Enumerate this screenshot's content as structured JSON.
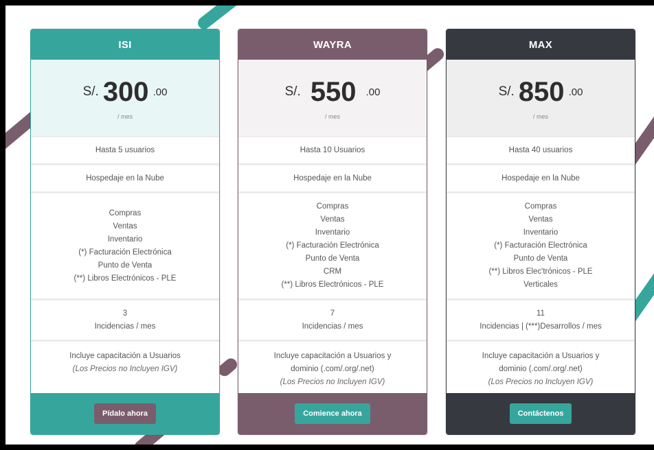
{
  "colors": {
    "teal": "#36a69d",
    "mauve": "#7a5d6d",
    "dark": "#363a40",
    "teal_tint": "#e9f6f6",
    "mauve_tint": "#f5f2f3",
    "dark_tint": "#eeeeef"
  },
  "plans": [
    {
      "name": "ISI",
      "currency": "S/.",
      "amount": "300",
      "decimals": ".00",
      "period": "/ mes",
      "users": "Hasta 5 usuarios",
      "hosting": "Hospedaje en la Nube",
      "features": [
        "Compras",
        "Ventas",
        "Inventario",
        "(*) Facturación Electrónica",
        "Punto de Venta",
        "(**) Libros Electrónicos - PLE"
      ],
      "incidents_count": "3",
      "incidents_label": "Incidencias / mes",
      "training": "Incluye capacitación a Usuarios",
      "training_extra": "",
      "note": "(Los Precios no Incluyen IGV)",
      "cta": "Pídalo ahora"
    },
    {
      "name": "WAYRA",
      "currency": "S/.",
      "amount": "550",
      "decimals": ".00",
      "period": "/ mes",
      "users": "Hasta 10 Usuarios",
      "hosting": "Hospedaje en la Nube",
      "features": [
        "Compras",
        "Ventas",
        "Inventario",
        "(*) Facturación Electrónica",
        "Punto de Venta",
        "CRM",
        "(**) Libros Electrónicos - PLE"
      ],
      "incidents_count": "7",
      "incidents_label": "Incidencias / mes",
      "training": "Incluye capacitación a Usuarios y",
      "training_extra": "dominio (.com/.org/.net)",
      "note": "(Los Precios no Incluyen IGV)",
      "cta": "Comience ahora"
    },
    {
      "name": "MAX",
      "currency": "S/.",
      "amount": "850",
      "decimals": ".00",
      "period": "/ mes",
      "users": "Hasta 40 usuarios",
      "hosting": "Hospedaje en la Nube",
      "features": [
        "Compras",
        "Ventas",
        "Inventario",
        "(*) Facturación Electrónica",
        "Punto de Venta",
        "(**) Libros Elec'trónicos - PLE",
        "Verticales"
      ],
      "incidents_count": "11",
      "incidents_label": "Incidencias | (***)Desarrollos / mes",
      "training": "Incluye capacitación a Usuarios y",
      "training_extra": "dominio (.com/.org/.net)",
      "note": "(Los Precios no Incluyen IGV)",
      "cta": "Contáctenos"
    }
  ]
}
